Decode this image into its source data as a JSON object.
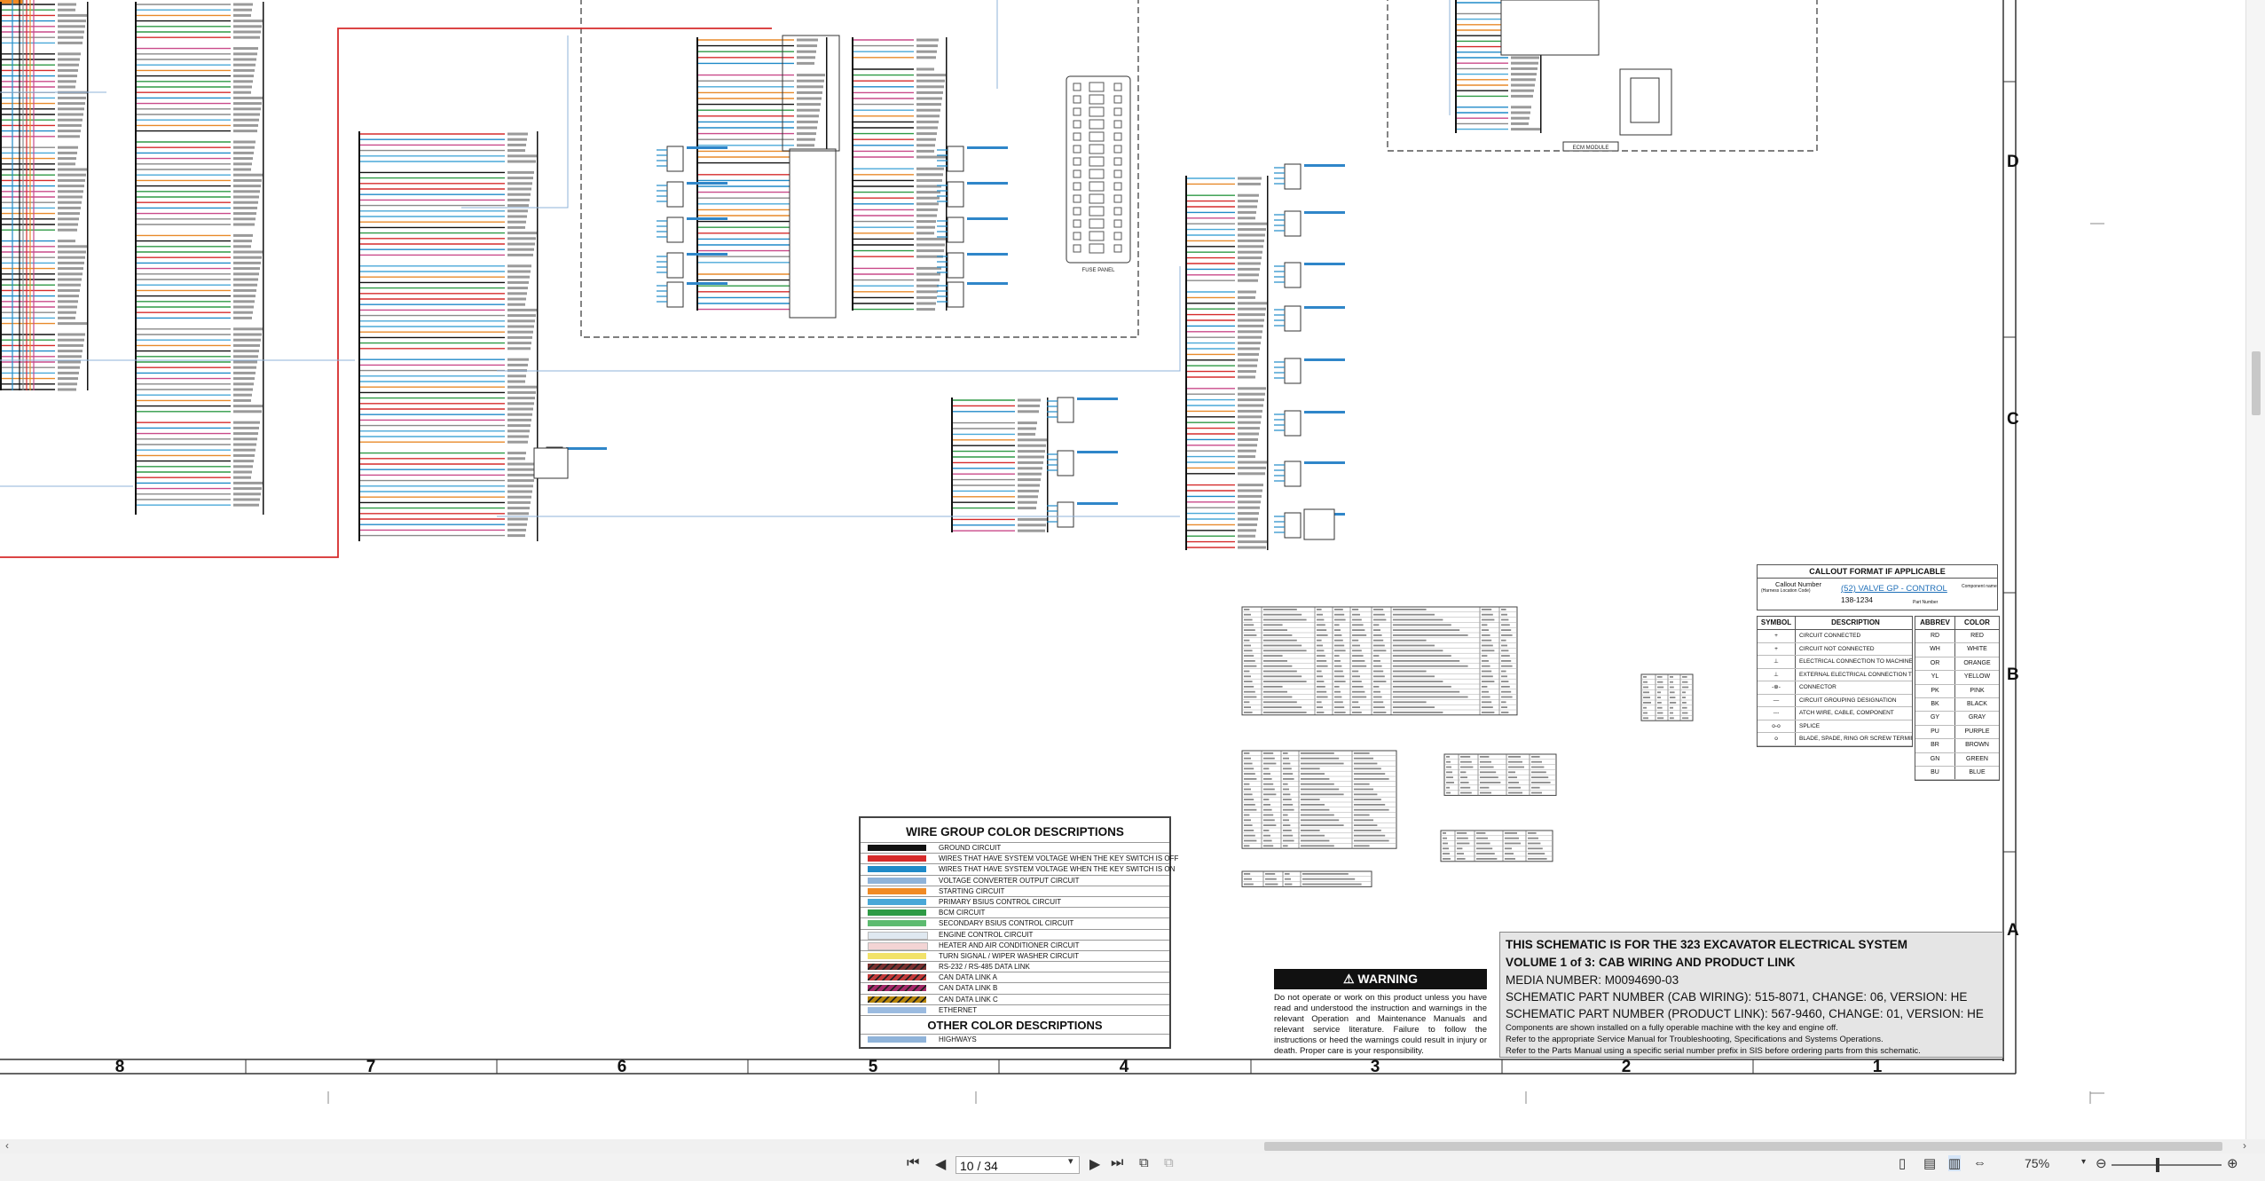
{
  "zones": {
    "rows": [
      "D",
      "C",
      "B",
      "A"
    ],
    "columns": [
      "8",
      "7",
      "6",
      "5",
      "4",
      "3",
      "2",
      "1"
    ]
  },
  "schematic_labels": {
    "fuse_panel": "FUSE PANEL",
    "ecm_module": "ECM MODULE"
  },
  "wire_legend": {
    "title": "WIRE GROUP COLOR DESCRIPTIONS",
    "items": [
      {
        "label": "GROUND CIRCUIT",
        "color": "#111111"
      },
      {
        "label": "WIRES THAT HAVE SYSTEM VOLTAGE WHEN THE KEY SWITCH IS OFF",
        "color": "#d62b2b"
      },
      {
        "label": "WIRES THAT HAVE SYSTEM VOLTAGE WHEN THE KEY SWITCH IS ON",
        "color": "#1f8ac8"
      },
      {
        "label": "VOLTAGE CONVERTER OUTPUT CIRCUIT",
        "color": "#8fb3d9"
      },
      {
        "label": "STARTING CIRCUIT",
        "color": "#f08a24"
      },
      {
        "label": "PRIMARY BSIUS CONTROL CIRCUIT",
        "color": "#49a8d8"
      },
      {
        "label": "BCM CIRCUIT",
        "color": "#2e9a45"
      },
      {
        "label": "SECONDARY BSIUS CONTROL CIRCUIT",
        "color": "#5dbb70"
      },
      {
        "label": "ENGINE CONTROL CIRCUIT",
        "color": "#dfe8f0"
      },
      {
        "label": "HEATER AND AIR CONDITIONER CIRCUIT",
        "color": "#f3d4d4"
      },
      {
        "label": "TURN SIGNAL / WIPER WASHER CIRCUIT",
        "color": "#f2e26a"
      },
      {
        "label": "RS-232 / RS-485 DATA LINK",
        "color": "#7a3030"
      },
      {
        "label": "CAN DATA LINK A",
        "color": "#c33a3a"
      },
      {
        "label": "CAN DATA LINK B",
        "color": "#a52a6a"
      },
      {
        "label": "CAN DATA LINK C",
        "color": "#b8860b"
      },
      {
        "label": "ETHERNET",
        "color": "#9bbbe0"
      }
    ],
    "other_title": "OTHER COLOR DESCRIPTIONS",
    "other_items": [
      {
        "label": "HIGHWAYS",
        "color": "#8fb3d9"
      }
    ]
  },
  "warning": {
    "title": "WARNING",
    "text": "Do not operate or work on this product unless you have read and understood the instruction and warnings in the relevant Operation and Maintenance Manuals and relevant service literature. Failure to follow the instructions or heed the warnings could result in injury or death. Proper care is your responsibility."
  },
  "title_block": {
    "line1": "THIS SCHEMATIC IS FOR THE 323 EXCAVATOR ELECTRICAL SYSTEM",
    "line2": "VOLUME 1 of 3: CAB WIRING AND PRODUCT LINK",
    "media": "MEDIA NUMBER: M0094690-03",
    "part1": "SCHEMATIC PART NUMBER (CAB WIRING): 515-8071, CHANGE: 06, VERSION: HE",
    "part2": "SCHEMATIC PART NUMBER (PRODUCT LINK): 567-9460, CHANGE: 01, VERSION: HE",
    "note1": "Components are shown installed on a fully operable machine with the key and engine off.",
    "note2": "Refer to the appropriate Service Manual for Troubleshooting, Specifications and Systems Operations.",
    "note3": "Refer to the Parts Manual using a specific serial number prefix in SIS before ordering parts from this schematic."
  },
  "callout": {
    "title": "CALLOUT FORMAT IF APPLICABLE",
    "callout_number": "Callout Number",
    "location": "(Harness Location Code)",
    "example": "(52) VALVE GP - CONTROL",
    "part_number": "138-1234",
    "component_name": "Component name",
    "part_label": "Part Number"
  },
  "symbol_table": {
    "header_symbol": "SYMBOL",
    "header_desc": "DESCRIPTION",
    "rows": [
      {
        "symbol": "+",
        "desc": "CIRCUIT CONNECTED"
      },
      {
        "symbol": "+",
        "desc": "CIRCUIT NOT CONNECTED"
      },
      {
        "symbol": "⊥",
        "desc": "ELECTRICAL CONNECTION TO MACHINE STRUCTURE"
      },
      {
        "symbol": "⊥",
        "desc": "EXTERNAL ELECTRICAL CONNECTION TO SURFACE OF COMPONENT"
      },
      {
        "symbol": "-⊕-",
        "desc": "CONNECTOR"
      },
      {
        "symbol": "—",
        "desc": "CIRCUIT GROUPING DESIGNATION"
      },
      {
        "symbol": "---",
        "desc": "ATCH WIRE, CABLE, COMPONENT"
      },
      {
        "symbol": "o-o",
        "desc": "SPLICE"
      },
      {
        "symbol": "o",
        "desc": "BLADE, SPADE, RING OR SCREW TERMINAL"
      }
    ]
  },
  "color_table": {
    "header_abbrev": "ABBREV",
    "header_color": "COLOR",
    "rows": [
      {
        "abbrev": "RD",
        "color": "RED"
      },
      {
        "abbrev": "WH",
        "color": "WHITE"
      },
      {
        "abbrev": "OR",
        "color": "ORANGE"
      },
      {
        "abbrev": "YL",
        "color": "YELLOW"
      },
      {
        "abbrev": "PK",
        "color": "PINK"
      },
      {
        "abbrev": "BK",
        "color": "BLACK"
      },
      {
        "abbrev": "GY",
        "color": "GRAY"
      },
      {
        "abbrev": "PU",
        "color": "PURPLE"
      },
      {
        "abbrev": "BR",
        "color": "BROWN"
      },
      {
        "abbrev": "GN",
        "color": "GREEN"
      },
      {
        "abbrev": "BU",
        "color": "BLUE"
      }
    ]
  },
  "toolbar": {
    "page_display": "10 / 34",
    "zoom": "75%",
    "first_icon": "first-page-icon",
    "prev_icon": "previous-page-icon",
    "next_icon": "next-page-icon",
    "last_icon": "last-page-icon"
  },
  "colors": {
    "red_wire": "#d62b2b",
    "blue_wire": "#1f8ac8",
    "highway": "#8fb3d9",
    "green_wire": "#2e9a45"
  }
}
